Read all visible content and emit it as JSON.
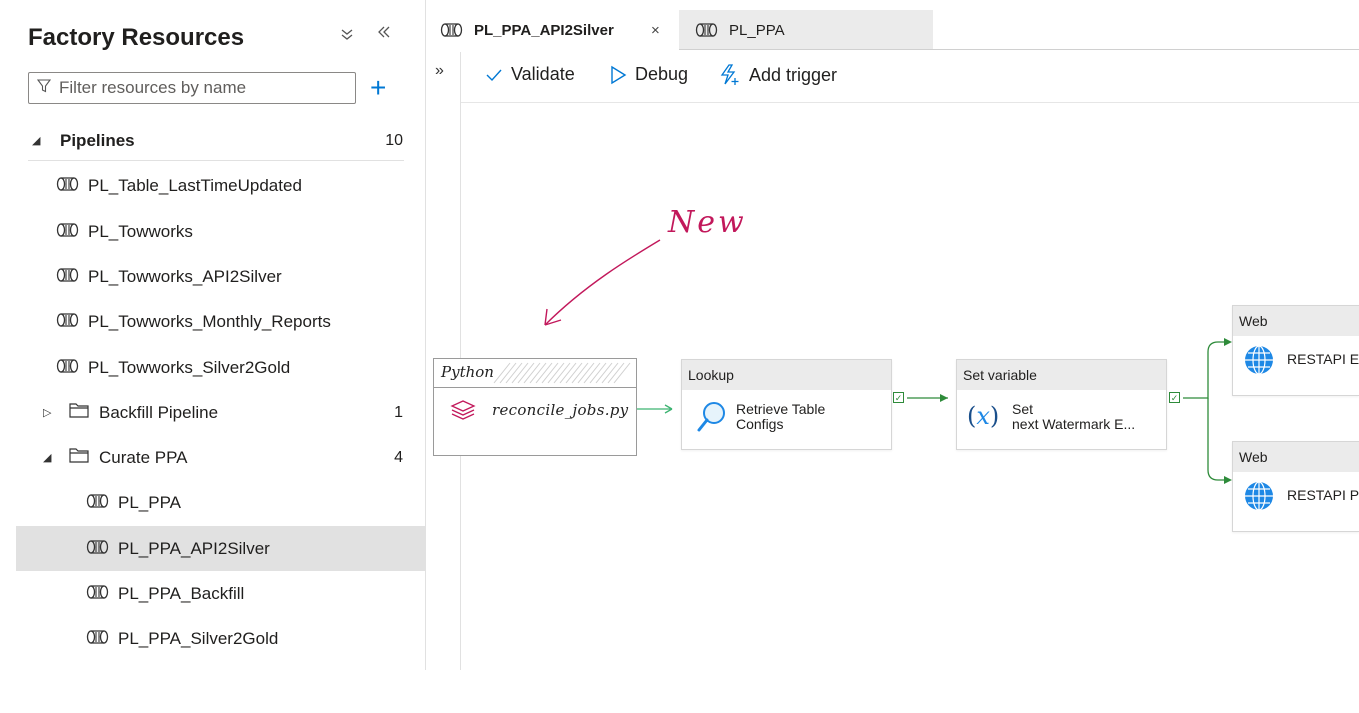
{
  "sidebar": {
    "title": "Factory Resources",
    "collapse_glyph": "»",
    "filter": {
      "placeholder": "Filter resources by name",
      "value": ""
    },
    "add_glyph": "+",
    "items": [
      {
        "kind": "header",
        "label": "Pipelines",
        "count": "10"
      },
      {
        "kind": "pipeline",
        "label": "PL_Table_LastTimeUpdated"
      },
      {
        "kind": "pipeline",
        "label": "PL_Towworks"
      },
      {
        "kind": "pipeline",
        "label": "PL_Towworks_API2Silver"
      },
      {
        "kind": "pipeline",
        "label": "PL_Towworks_Monthly_Reports"
      },
      {
        "kind": "pipeline",
        "label": "PL_Towworks_Silver2Gold"
      },
      {
        "kind": "folder",
        "label": "Backfill Pipeline",
        "count": "1",
        "expanded": false
      },
      {
        "kind": "folder",
        "label": "Curate PPA",
        "count": "4",
        "expanded": true
      },
      {
        "kind": "pipeline",
        "label": "PL_PPA"
      },
      {
        "kind": "pipeline",
        "label": "PL_PPA_API2Silver",
        "selected": true
      },
      {
        "kind": "pipeline",
        "label": "PL_PPA_Backfill"
      },
      {
        "kind": "pipeline",
        "label": "PL_PPA_Silver2Gold"
      }
    ]
  },
  "tabs": [
    {
      "label": "PL_PPA_API2Silver",
      "active": true,
      "close": "×"
    },
    {
      "label": "PL_PPA",
      "active": false
    }
  ],
  "expander_glyph": "»",
  "toolbar": {
    "validate": "Validate",
    "debug": "Debug",
    "add_trigger": "Add trigger"
  },
  "annotation": {
    "text": "New"
  },
  "activities": {
    "python": {
      "type": "Python",
      "file": "reconcile_jobs.py"
    },
    "lookup": {
      "type": "Lookup",
      "name_line1": "Retrieve Table",
      "name_line2": "Configs"
    },
    "setvar": {
      "type": "Set variable",
      "name_line1": "Set",
      "name_line2": "next Watermark E..."
    },
    "web1": {
      "type": "Web",
      "name": "RESTAPI Er"
    },
    "web2": {
      "type": "Web",
      "name": "RESTAPI Pa"
    }
  },
  "colors": {
    "accent": "#0078d4",
    "success": "#2e8b3a",
    "annotation": "#c2185b",
    "selected_row": "#e1e1e1"
  },
  "icons": {
    "pipeline": "pipeline-icon",
    "folder": "folder-icon",
    "lookup": "magnifier-icon",
    "variable": "variable-x-icon",
    "web": "globe-icon",
    "python": "python-layers-icon"
  }
}
